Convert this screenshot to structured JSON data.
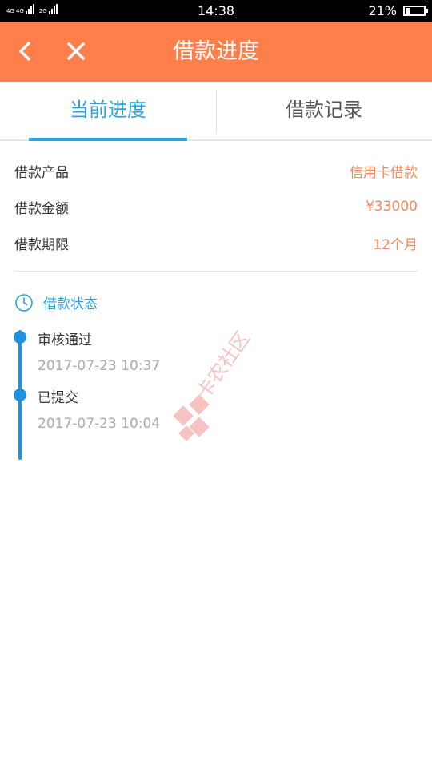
{
  "status_bar": {
    "network_left": "4G",
    "network_left2": "4G",
    "network_right": "2G",
    "time": "14:38",
    "battery_percent_text": "21%",
    "battery_level": 0.21
  },
  "header": {
    "title": "借款进度",
    "color": "#ff7f4a"
  },
  "tabs": [
    {
      "label": "当前进度",
      "active": true
    },
    {
      "label": "借款记录",
      "active": false
    }
  ],
  "loan_info": [
    {
      "label": "借款产品",
      "value": "信用卡借款"
    },
    {
      "label": "借款金额",
      "value": "¥33000"
    },
    {
      "label": "借款期限",
      "value": "12个月"
    }
  ],
  "status_section": {
    "title": "借款状态",
    "icon": "clock-icon"
  },
  "timeline": [
    {
      "title": "审核通过",
      "time": "2017-07-23 10:37"
    },
    {
      "title": "已提交",
      "time": "2017-07-23 10:04"
    }
  ],
  "watermark": {
    "text": "卡农社区",
    "color": "#f5b8b8"
  },
  "colors": {
    "accent_blue": "#2aa3dd",
    "value_orange": "#f08a5d",
    "timeline_blue": "#1e92e0"
  }
}
